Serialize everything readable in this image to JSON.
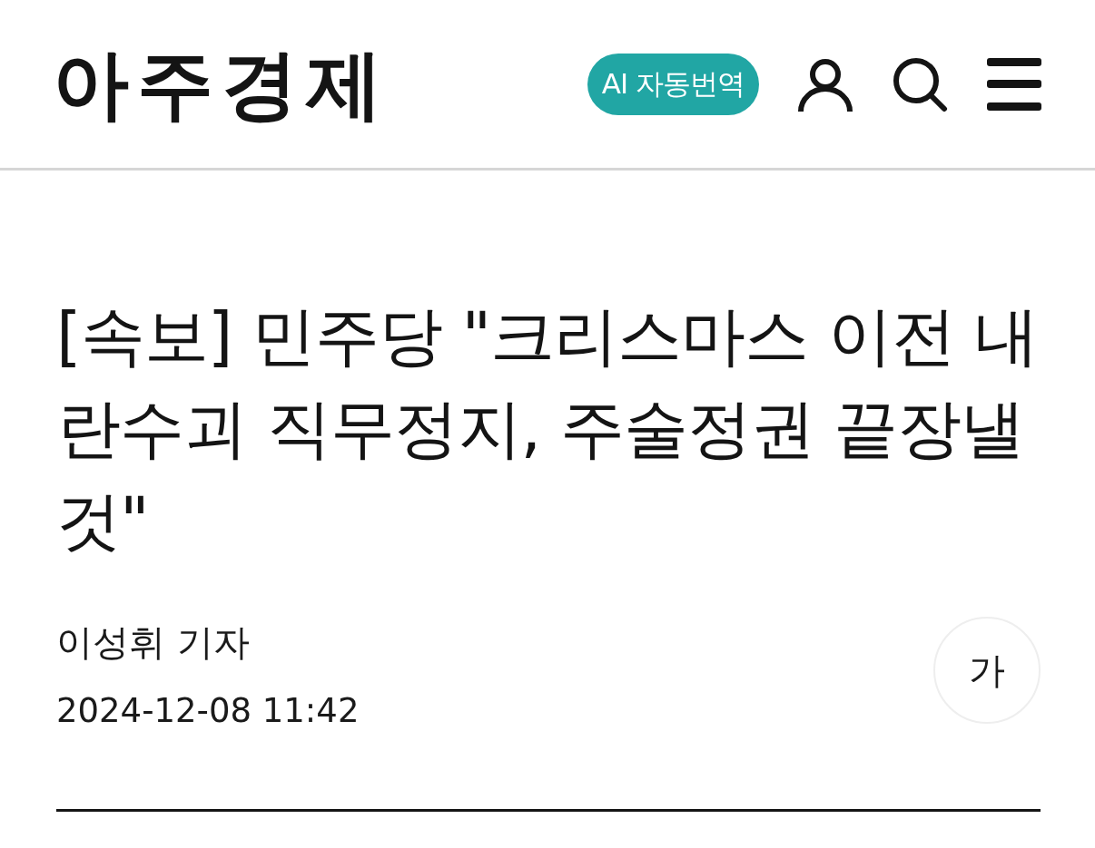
{
  "header": {
    "logo": "아주경제",
    "translate_button": "AI 자동번역"
  },
  "article": {
    "headline": "[속보] 민주당 \"크리스마스 이전 내란수괴 직무정지, 주술정권 끝장낼 것\"",
    "byline": "이성휘 기자",
    "date": "2024-12-08 11:42",
    "font_size_button": "가"
  }
}
